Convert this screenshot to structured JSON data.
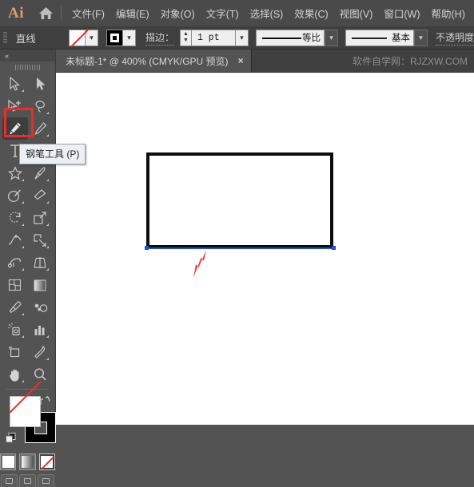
{
  "app": {
    "name": "Ai",
    "logo_color": "#d9a06a",
    "home_icon": "home-icon"
  },
  "menubar": {
    "items": [
      {
        "label": "文件(F)",
        "name": "menu-file"
      },
      {
        "label": "编辑(E)",
        "name": "menu-edit"
      },
      {
        "label": "对象(O)",
        "name": "menu-object"
      },
      {
        "label": "文字(T)",
        "name": "menu-type"
      },
      {
        "label": "选择(S)",
        "name": "menu-select"
      },
      {
        "label": "效果(C)",
        "name": "menu-effect"
      },
      {
        "label": "视图(V)",
        "name": "menu-view"
      },
      {
        "label": "窗口(W)",
        "name": "menu-window"
      },
      {
        "label": "帮助(H)",
        "name": "menu-help"
      }
    ]
  },
  "controlbar": {
    "object_label": "直线",
    "fill_swatch": "none-swatch",
    "stroke_swatch": "black-stroke-swatch",
    "stroke_label": "描边：",
    "stroke_weight": "1 pt",
    "width_profile": "等比",
    "brush_definition": "基本",
    "opacity_label": "不透明度"
  },
  "tabbar": {
    "document_title": "未标题-1* @ 400% (CMYK/GPU 预览)",
    "close_glyph": "×",
    "watermark": "软件自学网：RJZXW.COM"
  },
  "toolbox": {
    "collapse_glyph": "«",
    "tools": [
      {
        "name": "selection-tool",
        "label": "选择工具"
      },
      {
        "name": "direct-selection-tool",
        "label": "直接选择工具"
      },
      {
        "name": "magic-wand-tool",
        "label": "魔棒工具"
      },
      {
        "name": "lasso-tool",
        "label": "套索工具"
      },
      {
        "name": "pen-tool",
        "label": "钢笔工具",
        "active": true
      },
      {
        "name": "curvature-tool",
        "label": "曲率工具"
      },
      {
        "name": "type-tool",
        "label": "文字工具"
      },
      {
        "name": "line-segment-tool",
        "label": "直线段工具"
      },
      {
        "name": "shape-tool",
        "label": "矩形工具"
      },
      {
        "name": "paintbrush-tool",
        "label": "画笔工具"
      },
      {
        "name": "shaper-tool",
        "label": "Shaper 工具"
      },
      {
        "name": "eraser-tool",
        "label": "橡皮擦工具"
      },
      {
        "name": "rotate-tool",
        "label": "旋转工具"
      },
      {
        "name": "scale-tool",
        "label": "比例缩放工具"
      },
      {
        "name": "width-tool",
        "label": "宽度工具"
      },
      {
        "name": "free-transform-tool",
        "label": "自由变换工具"
      },
      {
        "name": "shape-builder-tool",
        "label": "形状生成器工具"
      },
      {
        "name": "perspective-grid-tool",
        "label": "透视网格工具"
      },
      {
        "name": "mesh-tool",
        "label": "网格工具"
      },
      {
        "name": "gradient-tool",
        "label": "渐变工具"
      },
      {
        "name": "eyedropper-tool",
        "label": "吸管工具"
      },
      {
        "name": "blend-tool",
        "label": "混合工具"
      },
      {
        "name": "symbol-sprayer-tool",
        "label": "符号喷枪工具"
      },
      {
        "name": "column-graph-tool",
        "label": "柱形图工具"
      },
      {
        "name": "artboard-tool",
        "label": "画板工具"
      },
      {
        "name": "slice-tool",
        "label": "切片工具"
      },
      {
        "name": "hand-tool",
        "label": "抓手工具"
      },
      {
        "name": "zoom-tool",
        "label": "缩放工具"
      }
    ],
    "fill_stroke": {
      "fill": "none",
      "stroke": "black",
      "swap_icon": "swap-fill-stroke-icon",
      "default_icon": "default-fill-stroke-icon"
    },
    "paint_modes": [
      {
        "name": "color-mode-button",
        "type": "solid"
      },
      {
        "name": "gradient-mode-button",
        "type": "gradient"
      },
      {
        "name": "none-mode-button",
        "type": "none",
        "selected": true
      }
    ],
    "screen_modes": [
      {
        "name": "screen-mode-normal"
      },
      {
        "name": "screen-mode-fullscreen-menu"
      },
      {
        "name": "screen-mode-fullscreen"
      }
    ]
  },
  "tooltip": {
    "text": "钢笔工具 (P)"
  },
  "canvas": {
    "artwork": {
      "name": "rectangle-path",
      "stroke_color": "#0d0d0d",
      "fill_color": "#ffffff"
    },
    "selection": {
      "name": "selected-line-segment",
      "color": "#2051d8"
    },
    "annotation": {
      "name": "red-arrow-annotation",
      "color": "#f03b34"
    }
  }
}
